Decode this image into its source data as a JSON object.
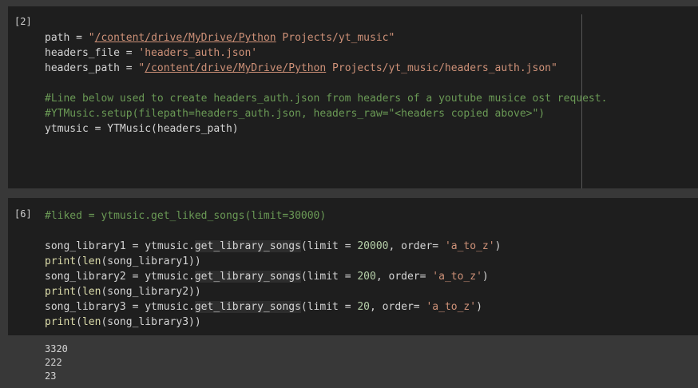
{
  "cells": [
    {
      "prompt": "[2]",
      "lines": [
        [
          {
            "t": "path = ",
            "c": ""
          },
          {
            "t": "\"",
            "c": "str"
          },
          {
            "t": "/content/drive/MyDrive/Python",
            "c": "str-link"
          },
          {
            "t": " Projects/yt_music\"",
            "c": "str"
          }
        ],
        [
          {
            "t": "headers_file = ",
            "c": ""
          },
          {
            "t": "'headers_auth.json'",
            "c": "str"
          }
        ],
        [
          {
            "t": "headers_path = ",
            "c": ""
          },
          {
            "t": "\"",
            "c": "str"
          },
          {
            "t": "/content/drive/MyDrive/Python",
            "c": "str-link"
          },
          {
            "t": " Projects/yt_music/headers_auth.json\"",
            "c": "str"
          }
        ],
        [],
        [
          {
            "t": "#Line below used to create headers_auth.json from headers of a youtube musice ost request.",
            "c": "com"
          }
        ],
        [
          {
            "t": "#YTMusic.setup(filepath=headers_auth.json, headers_raw=\"<headers copied above>\")",
            "c": "com"
          }
        ],
        [
          {
            "t": "ytmusic = YTMusic(headers_path)",
            "c": ""
          }
        ]
      ]
    },
    {
      "prompt": "[6]",
      "lines": [
        [
          {
            "t": "#liked = ytmusic.get_liked_songs(limit=30000)",
            "c": "com"
          }
        ],
        [],
        [
          {
            "t": "song_library1 = ytmusic.",
            "c": ""
          },
          {
            "t": "get_library_songs",
            "c": "hl"
          },
          {
            "t": "(limit = ",
            "c": ""
          },
          {
            "t": "20000",
            "c": "num"
          },
          {
            "t": ", order= ",
            "c": ""
          },
          {
            "t": "'a_to_z'",
            "c": "str"
          },
          {
            "t": ")",
            "c": ""
          }
        ],
        [
          {
            "t": "print",
            "c": "fn"
          },
          {
            "t": "(",
            "c": ""
          },
          {
            "t": "len",
            "c": "fn"
          },
          {
            "t": "(song_library1))",
            "c": ""
          }
        ],
        [
          {
            "t": "song_library2 = ytmusic.",
            "c": ""
          },
          {
            "t": "get_library_songs",
            "c": "hl"
          },
          {
            "t": "(limit = ",
            "c": ""
          },
          {
            "t": "200",
            "c": "num"
          },
          {
            "t": ", order= ",
            "c": ""
          },
          {
            "t": "'a_to_z'",
            "c": "str"
          },
          {
            "t": ")",
            "c": ""
          }
        ],
        [
          {
            "t": "print",
            "c": "fn"
          },
          {
            "t": "(",
            "c": ""
          },
          {
            "t": "len",
            "c": "fn"
          },
          {
            "t": "(song_library2))",
            "c": ""
          }
        ],
        [
          {
            "t": "song_library3 = ytmusic.",
            "c": ""
          },
          {
            "t": "get_library_songs",
            "c": "hl"
          },
          {
            "t": "(limit = ",
            "c": ""
          },
          {
            "t": "20",
            "c": "num"
          },
          {
            "t": ", order= ",
            "c": ""
          },
          {
            "t": "'a_to_z'",
            "c": "str"
          },
          {
            "t": ")",
            "c": ""
          }
        ],
        [
          {
            "t": "print",
            "c": "fn"
          },
          {
            "t": "(",
            "c": ""
          },
          {
            "t": "len",
            "c": "fn"
          },
          {
            "t": "(song_library3))",
            "c": ""
          }
        ]
      ]
    }
  ],
  "output": [
    "3320",
    "222",
    "23"
  ]
}
